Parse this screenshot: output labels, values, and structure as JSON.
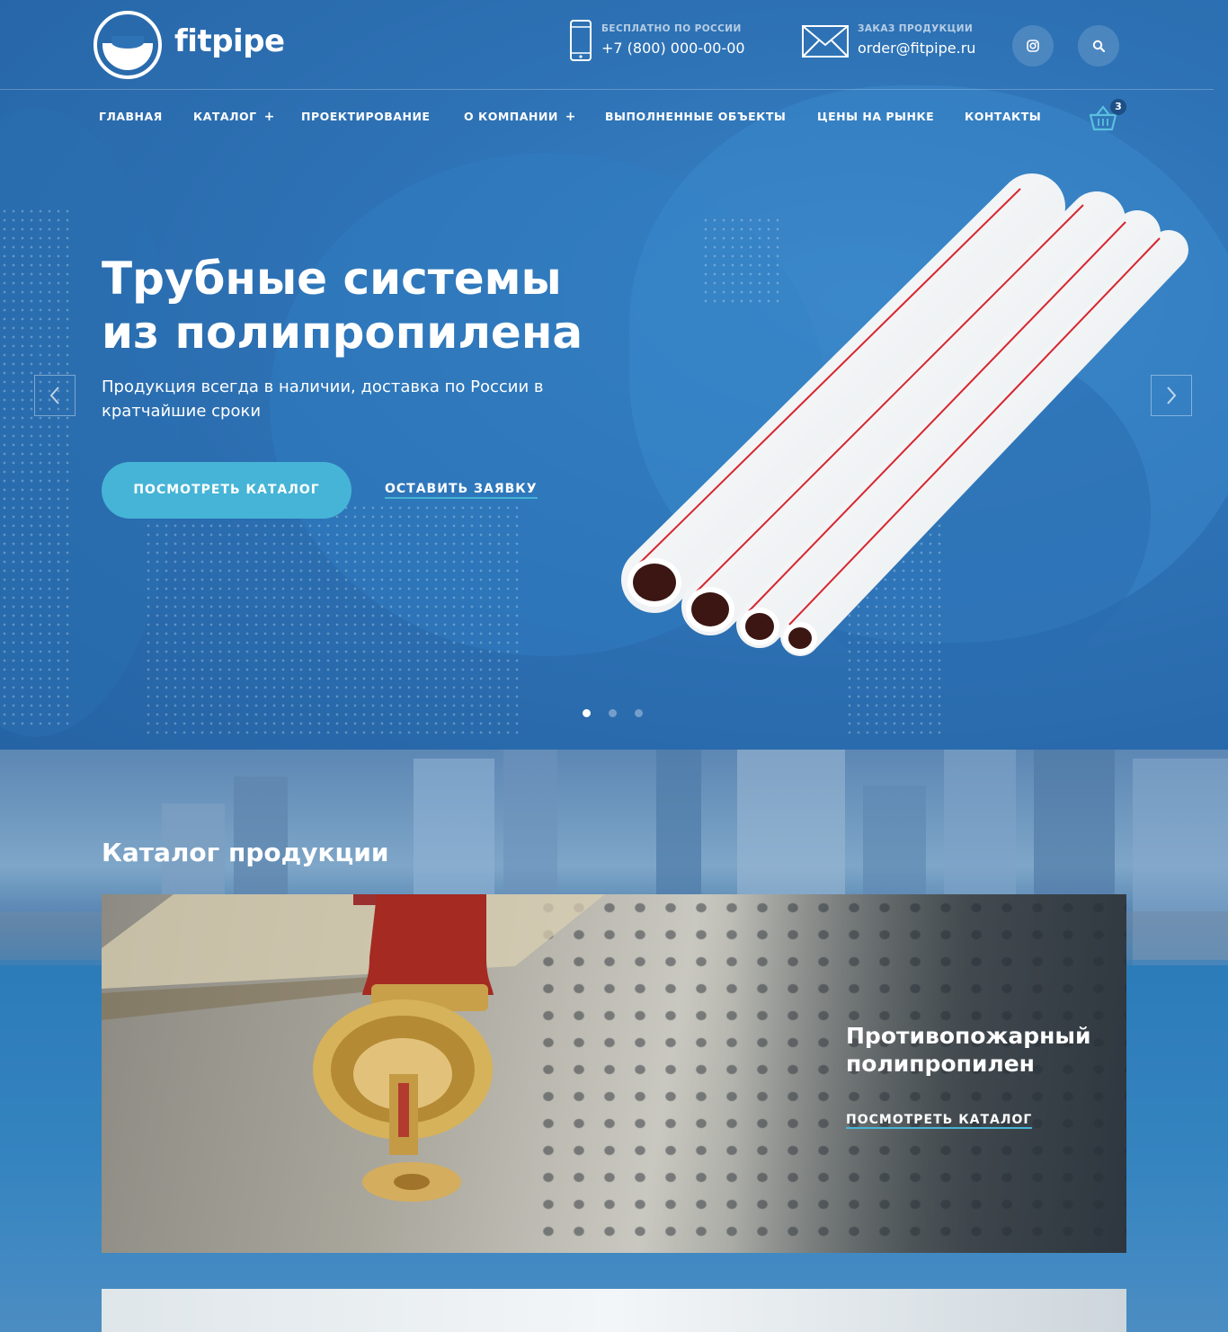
{
  "brand": {
    "name": "fitpipe"
  },
  "contacts": {
    "phone": {
      "caption": "БЕСПЛАТНО ПО РОССИИ",
      "value": "+7 (800) 000-00-00"
    },
    "email": {
      "caption": "ЗАКАЗ ПРОДУКЦИИ",
      "value": "order@fitpipe.ru"
    }
  },
  "nav": {
    "items": [
      {
        "label": "ГЛАВНАЯ"
      },
      {
        "label": "КАТАЛОГ",
        "expand": "+"
      },
      {
        "label": "ПРОЕКТИРОВАНИЕ"
      },
      {
        "label": "О КОМПАНИИ",
        "expand": "+"
      },
      {
        "label": "ВЫПОЛНЕННЫЕ ОБЪЕКТЫ"
      },
      {
        "label": "ЦЕНЫ НА РЫНКЕ"
      },
      {
        "label": "КОНТАКТЫ"
      }
    ],
    "cart_count": "3"
  },
  "hero": {
    "title_line1": "Трубные системы",
    "title_line2": "из полипропилена",
    "subtitle": "Продукция всегда в наличии, доставка по России в кратчайшие сроки",
    "primary_button": "ПОСМОТРЕТЬ КАТАЛОГ",
    "secondary_button": "ОСТАВИТЬ ЗАЯВКУ",
    "slides_total": 3,
    "active_slide": 1
  },
  "catalog": {
    "title": "Каталог продукции",
    "card": {
      "title_line1": "Противопожарный",
      "title_line2": "полипропилен",
      "link": "ПОСМОТРЕТЬ КАТАЛОГ"
    }
  },
  "colors": {
    "hero_bg": "#2e73b6",
    "accent": "#46b4d6",
    "pipe_stripe": "#d7262e"
  },
  "icons": {
    "phone": "smartphone-icon",
    "email": "envelope-icon",
    "social": "instagram-icon",
    "search": "search-icon",
    "cart": "basket-icon",
    "prev": "chevron-left-icon",
    "next": "chevron-right-icon"
  }
}
